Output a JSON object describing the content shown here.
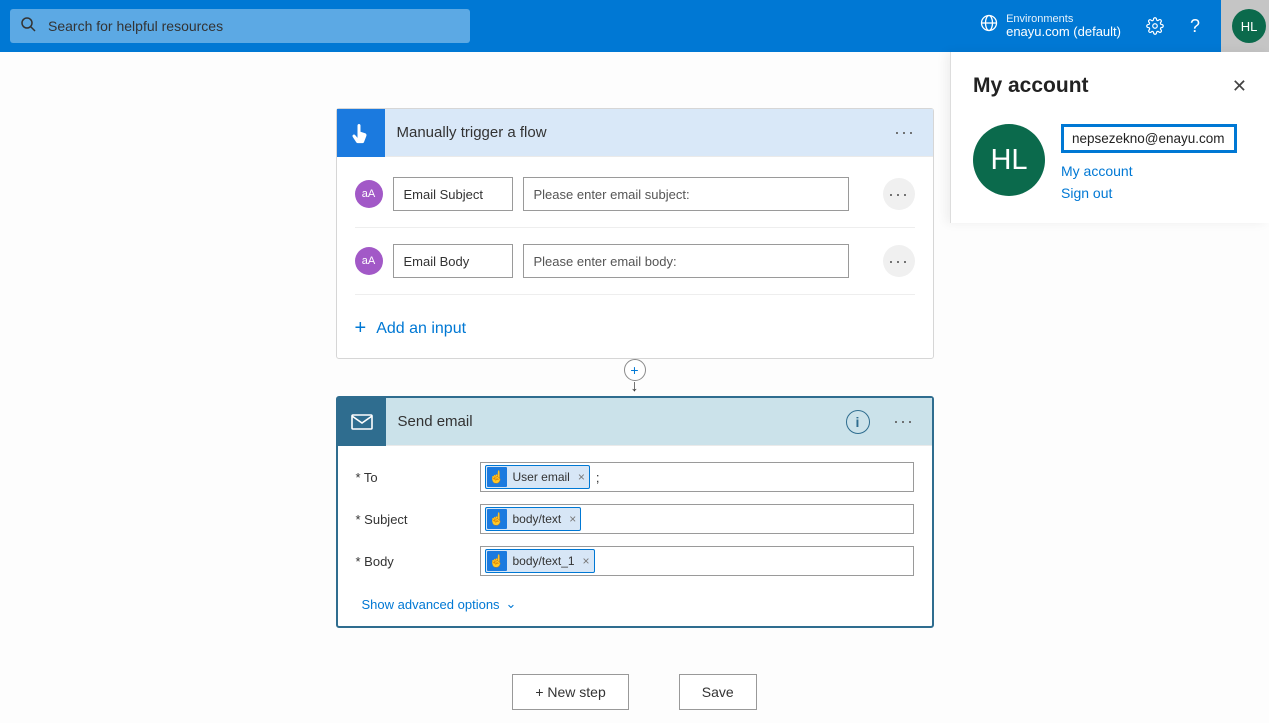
{
  "topbar": {
    "search_placeholder": "Search for helpful resources",
    "env_label": "Environments",
    "env_name": "enayu.com (default)",
    "avatar_initials": "HL"
  },
  "trigger_card": {
    "title": "Manually trigger a flow",
    "icon_glyph": "aA",
    "params": [
      {
        "label": "Email Subject",
        "placeholder": "Please enter email subject:"
      },
      {
        "label": "Email Body",
        "placeholder": "Please enter email body:"
      }
    ],
    "add_input_label": "Add an input"
  },
  "action_card": {
    "title": "Send email",
    "rows": [
      {
        "label": "* To",
        "tokens": [
          "User email"
        ],
        "suffix": ";"
      },
      {
        "label": "* Subject",
        "tokens": [
          "body/text"
        ],
        "suffix": ""
      },
      {
        "label": "* Body",
        "tokens": [
          "body/text_1"
        ],
        "suffix": ""
      }
    ],
    "advanced_label": "Show advanced options"
  },
  "buttons": {
    "new_step": "+ New step",
    "save": "Save"
  },
  "account_panel": {
    "title": "My account",
    "avatar_initials": "HL",
    "email": "nepsezekno@enayu.com",
    "link_account": "My account",
    "link_signout": "Sign out"
  }
}
